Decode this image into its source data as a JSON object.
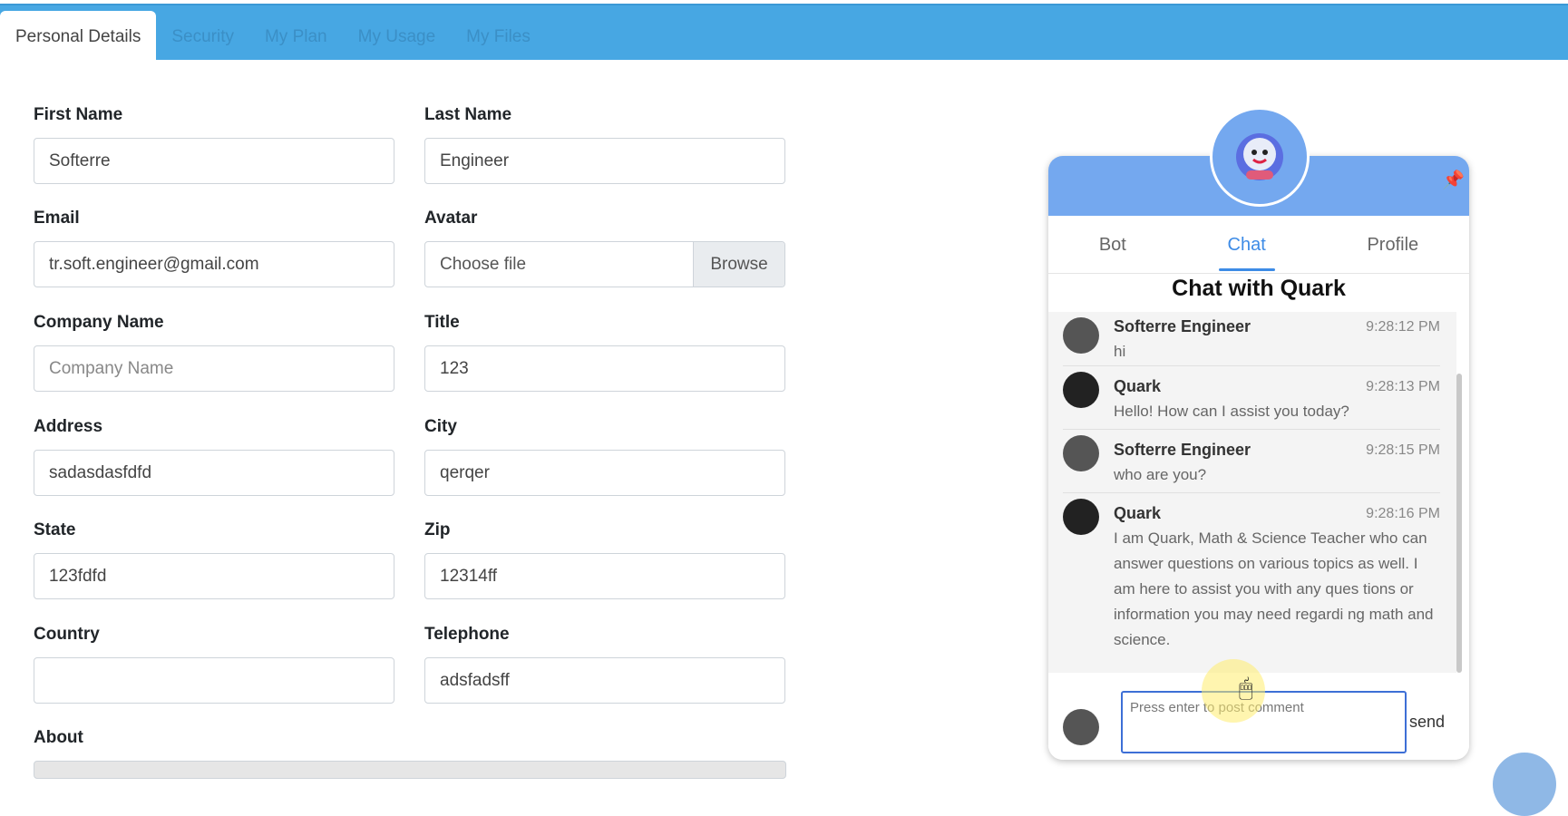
{
  "tabs": [
    {
      "label": "Personal Details"
    },
    {
      "label": "Security"
    },
    {
      "label": "My Plan"
    },
    {
      "label": "My Usage"
    },
    {
      "label": "My Files"
    }
  ],
  "form": {
    "first_name": {
      "label": "First Name",
      "value": "Softerre"
    },
    "last_name": {
      "label": "Last Name",
      "value": "Engineer"
    },
    "email": {
      "label": "Email",
      "value": "tr.soft.engineer@gmail.com"
    },
    "avatar": {
      "label": "Avatar",
      "choose": "Choose file",
      "browse": "Browse"
    },
    "company": {
      "label": "Company Name",
      "value": "",
      "placeholder": "Company Name"
    },
    "title": {
      "label": "Title",
      "value": "123"
    },
    "address": {
      "label": "Address",
      "value": "sadasdasfdfd"
    },
    "city": {
      "label": "City",
      "value": "qerqer"
    },
    "state": {
      "label": "State",
      "value": "123fdfd"
    },
    "zip": {
      "label": "Zip",
      "value": "12314ff"
    },
    "country": {
      "label": "Country",
      "value": ""
    },
    "telephone": {
      "label": "Telephone",
      "value": "adsfadsff"
    },
    "about": {
      "label": "About"
    }
  },
  "chat": {
    "tabs": [
      "Bot",
      "Chat",
      "Profile"
    ],
    "title": "Chat with Quark",
    "messages": [
      {
        "name": "Softerre Engineer",
        "time": "9:28:12 PM",
        "text": "hi"
      },
      {
        "name": "Quark",
        "time": "9:28:13 PM",
        "text": "Hello! How can I assist you today?"
      },
      {
        "name": "Softerre Engineer",
        "time": "9:28:15 PM",
        "text": "who are you?"
      },
      {
        "name": "Quark",
        "time": "9:28:16 PM",
        "text": "I am Quark, Math & Science Teacher who can answer questions on various topics as well. I am here to assist you with any ques tions or information you may need regardi ng math and science."
      }
    ],
    "compose_placeholder": "Press enter to post comment",
    "send_label": "send",
    "header_color": "#74a8ef",
    "accent_color": "#3d8be6"
  },
  "colors": {
    "topbar": "#47a7e3"
  }
}
